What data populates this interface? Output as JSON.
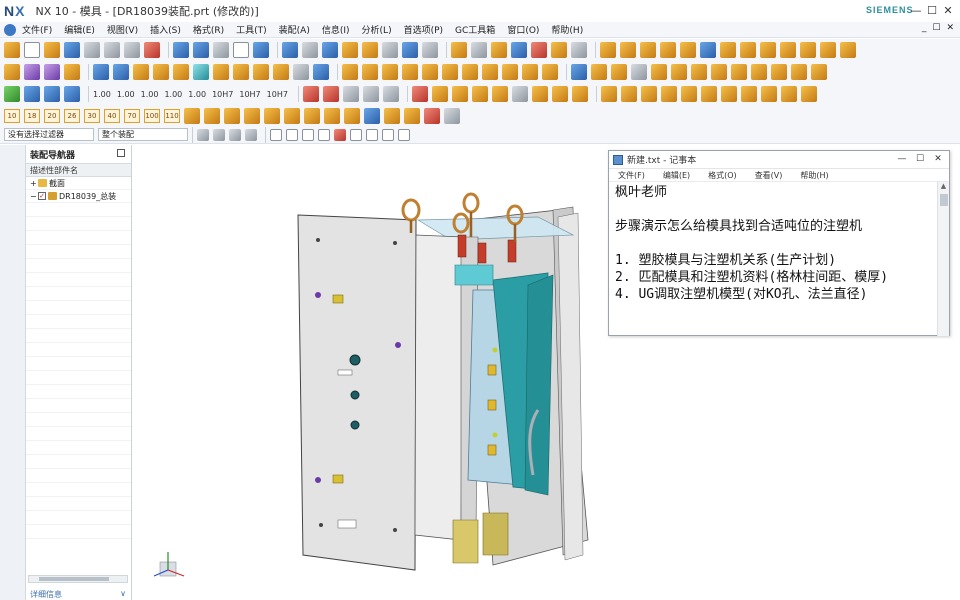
{
  "app": {
    "logo_n": "N",
    "logo_x": "X",
    "title": "NX 10 - 模具 - [DR18039装配.prt (修改的)]",
    "brand": "SIEMENS",
    "win_min": "—",
    "win_max": "☐",
    "win_close": "✕"
  },
  "menubar": {
    "items": [
      "文件(F)",
      "编辑(E)",
      "视图(V)",
      "插入(S)",
      "格式(R)",
      "工具(T)",
      "装配(A)",
      "信息(I)",
      "分析(L)",
      "首选项(P)",
      "GC工具箱",
      "窗口(O)",
      "帮助(H)"
    ],
    "right": [
      "_",
      "☐",
      "✕"
    ]
  },
  "toolbar4_nums": [
    "10",
    "18",
    "20",
    "26",
    "30",
    "40",
    "70",
    "100",
    "110"
  ],
  "selbar": {
    "filter": "没有选择过滤器",
    "scope": "整个装配"
  },
  "navigator": {
    "title": "装配导航器",
    "column": "描述性部件名",
    "rows": [
      "截面",
      "DR18039_总装"
    ],
    "footer_left": "详细信息",
    "footer_right": "∨"
  },
  "notepad": {
    "title": "新建.txt - 记事本",
    "menu": [
      "文件(F)",
      "编辑(E)",
      "格式(O)",
      "查看(V)",
      "帮助(H)"
    ],
    "lines": [
      "枫叶老师",
      "",
      "步骤演示怎么给模具找到合适吨位的注塑机",
      "",
      "1. 塑胶模具与注塑机关系(生产计划)",
      "2. 匹配模具和注塑机资料(格林柱间距、模厚)",
      "4. UG调取注塑机模型(对KO孔、法兰直径)"
    ]
  },
  "colors": {
    "accent": "#3a6fb0",
    "brand": "#2f8f9d",
    "mold_plate": "#e2e3e2",
    "mold_blue": "#b6d6e6",
    "mold_teal": "#2a9ea4",
    "mold_yellow": "#d8c86a"
  }
}
